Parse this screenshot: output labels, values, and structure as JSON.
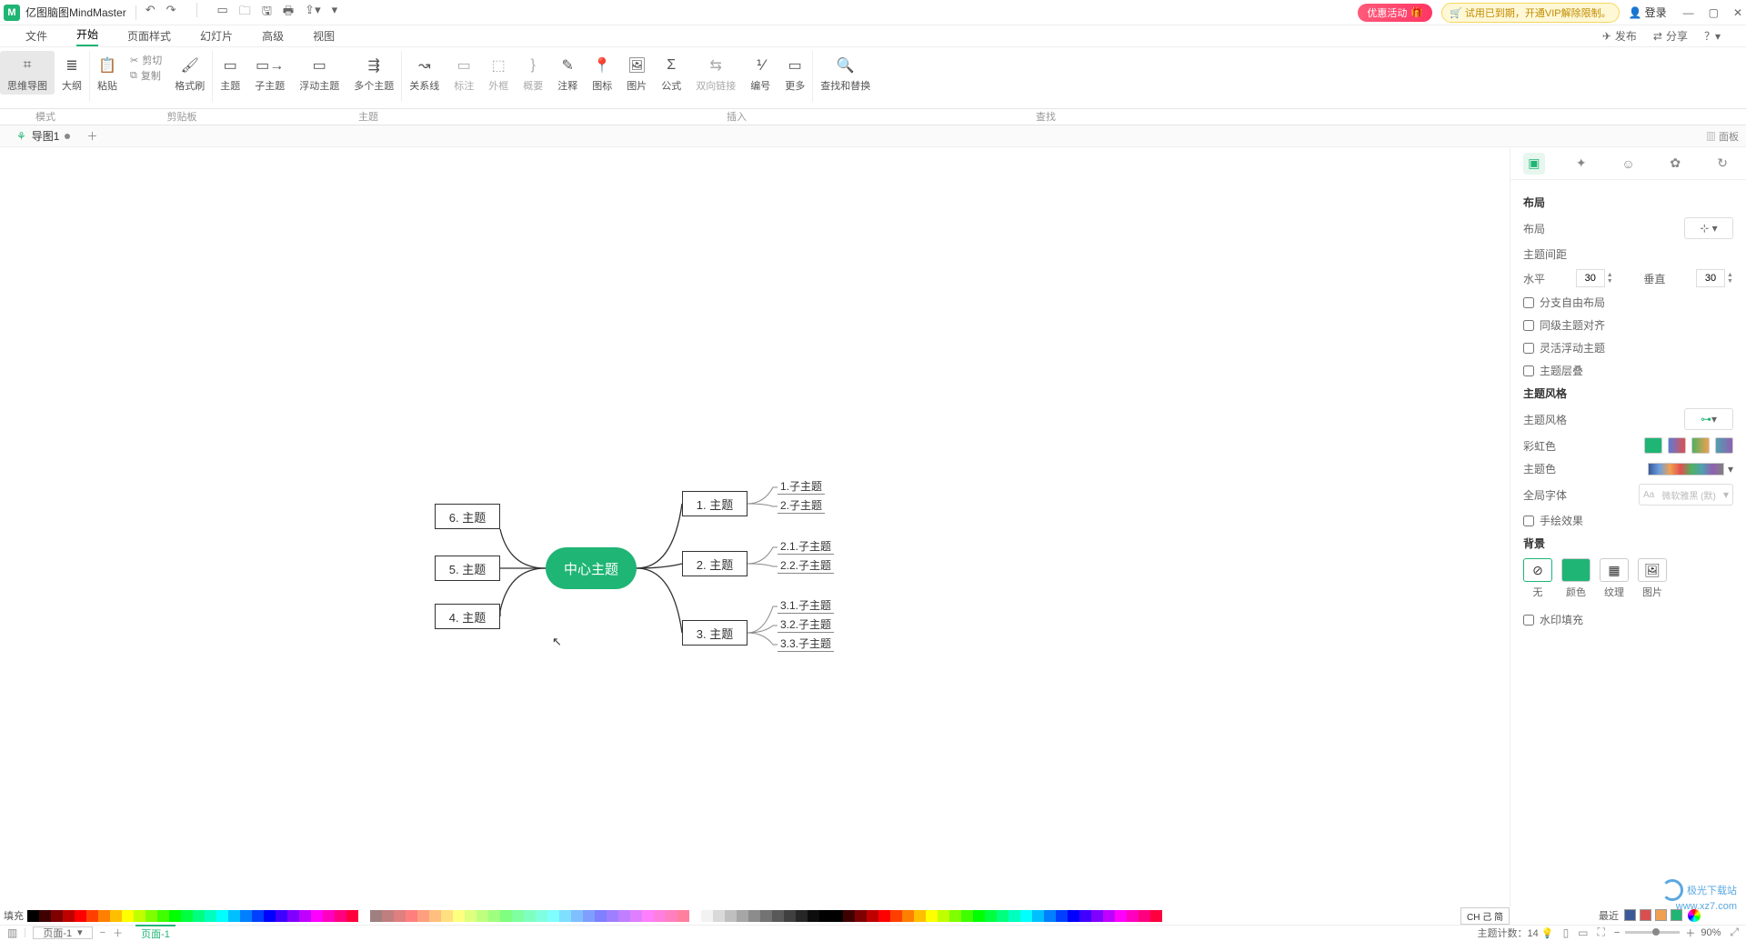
{
  "title_bar": {
    "app_name": "亿图脑图MindMaster",
    "promo": "优惠活动",
    "vip_msg": "试用已到期，开通VIP解除限制。",
    "login": "登录"
  },
  "menu": {
    "items": [
      "文件",
      "开始",
      "页面样式",
      "幻灯片",
      "高级",
      "视图"
    ],
    "publish": "发布",
    "share": "分享"
  },
  "ribbon": {
    "mode_mind": "思维导图",
    "mode_outline": "大纲",
    "paste": "粘贴",
    "cut": "剪切",
    "copy": "复制",
    "format_painter": "格式刷",
    "topic": "主题",
    "subtopic": "子主题",
    "floating": "浮动主题",
    "multi": "多个主题",
    "relation": "关系线",
    "callout": "标注",
    "boundary": "外框",
    "summary": "概要",
    "note": "注释",
    "icon": "图标",
    "image": "图片",
    "formula": "公式",
    "bilink": "双向链接",
    "number": "编号",
    "more": "更多",
    "find_replace": "查找和替换",
    "grp_mode": "模式",
    "grp_clip": "剪贴板",
    "grp_topic": "主题",
    "grp_insert": "插入",
    "grp_search": "查找"
  },
  "tabs": {
    "doc1": "导图1",
    "panel": "面板"
  },
  "mindmap": {
    "center": "中心主题",
    "t1": "1. 主题",
    "t1s1": "1.子主题",
    "t1s2": "2.子主题",
    "t2": "2. 主题",
    "t2s1": "2.1.子主题",
    "t2s2": "2.2.子主题",
    "t3": "3. 主题",
    "t3s1": "3.1.子主题",
    "t3s2": "3.2.子主题",
    "t3s3": "3.3.子主题",
    "t4": "4. 主题",
    "t5": "5. 主题",
    "t6": "6. 主题"
  },
  "side": {
    "sec_layout": "布局",
    "lbl_layout": "布局",
    "sec_spacing": "主题间距",
    "lbl_h": "水平",
    "val_h": "30",
    "lbl_v": "垂直",
    "val_v": "30",
    "chk_free": "分支自由布局",
    "chk_align": "同级主题对齐",
    "chk_flex_float": "灵活浮动主题",
    "chk_stack": "主题层叠",
    "sec_style": "主题风格",
    "lbl_style": "主题风格",
    "lbl_rainbow": "彩虹色",
    "lbl_theme_color": "主题色",
    "lbl_font": "全局字体",
    "font_placeholder": "微软雅黑 (默)",
    "chk_hand": "手绘效果",
    "sec_bg": "背景",
    "bg_none": "无",
    "bg_color": "颜色",
    "bg_texture": "纹理",
    "bg_image": "图片",
    "chk_watermark": "水印填充"
  },
  "color_bar": {
    "fill": "填充",
    "recent": "最近"
  },
  "status": {
    "page_combo": "页面-1",
    "page_tab": "页面-1",
    "topic_count_lbl": "主题计数：",
    "topic_count": "14",
    "zoom": "90%",
    "lang": "CH 己 简"
  },
  "watermark": {
    "text1": "极光下载站",
    "text2": "www.xz7.com"
  }
}
